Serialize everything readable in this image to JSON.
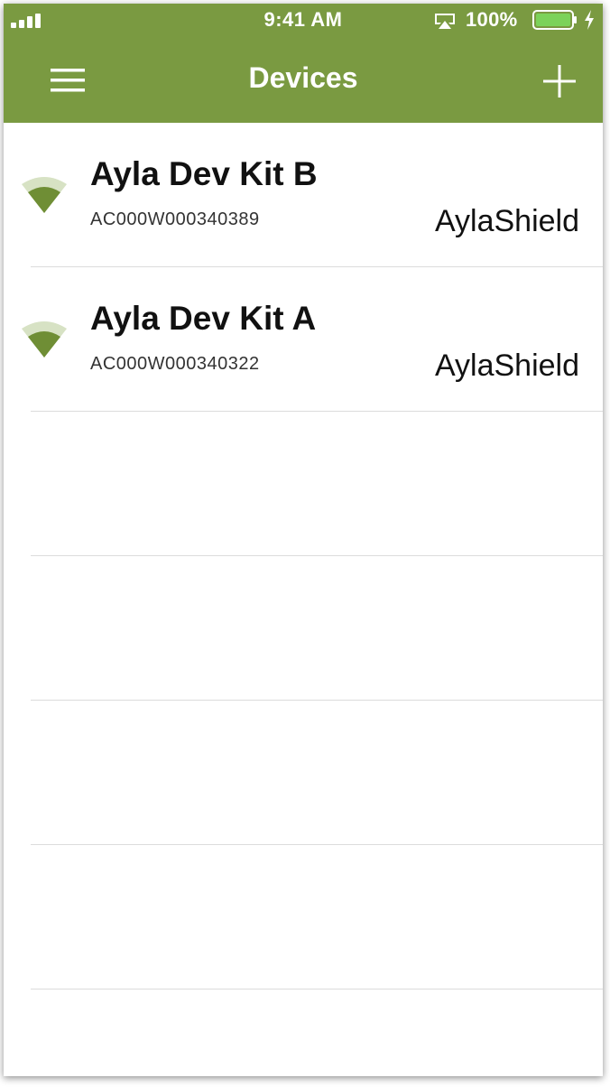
{
  "status_bar": {
    "time": "9:41 AM",
    "battery_percent": "100%",
    "battery_level": 1.0,
    "signal_icon": "cellular-signal-icon",
    "airplay_icon": "airplay-icon",
    "battery_icon": "battery-icon",
    "charging_icon": "charging-bolt-icon"
  },
  "nav_bar": {
    "title": "Devices",
    "menu_icon": "hamburger-menu-icon",
    "add_icon": "plus-icon",
    "background_color": "#7a9a41"
  },
  "devices": [
    {
      "name": "Ayla Dev Kit B",
      "dsn": "AC000W000340389",
      "model": "AylaShield",
      "icon": "wifi-signal-icon"
    },
    {
      "name": "Ayla Dev Kit A",
      "dsn": "AC000W000340322",
      "model": "AylaShield",
      "icon": "wifi-signal-icon"
    }
  ],
  "colors": {
    "accent": "#7a9a41",
    "wifi_dark": "#6f8e35",
    "wifi_light": "#d7e2c4",
    "battery_fill": "#7cd25a"
  }
}
